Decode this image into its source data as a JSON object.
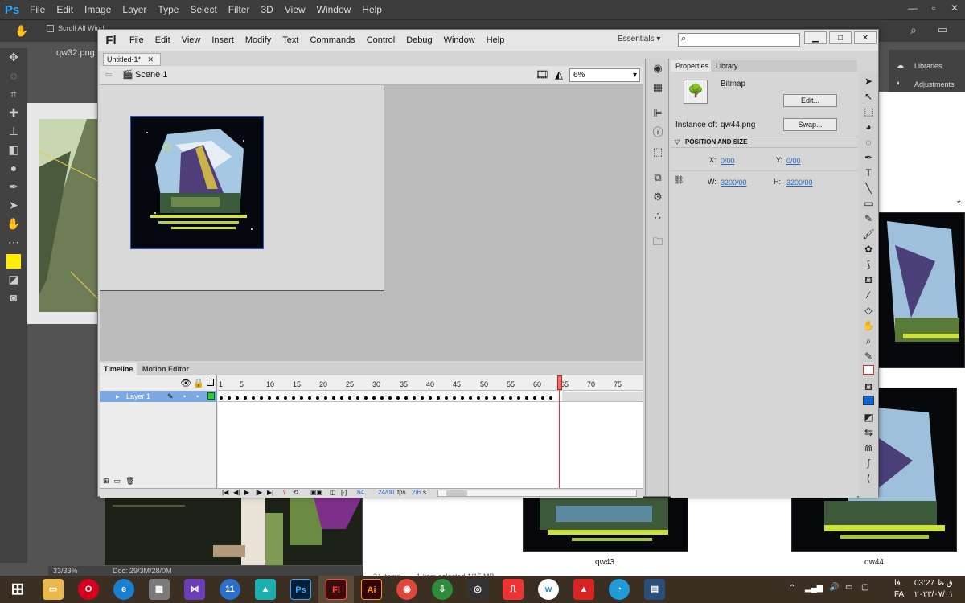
{
  "photoshop": {
    "logo": "Ps",
    "menu": [
      "File",
      "Edit",
      "Image",
      "Layer",
      "Type",
      "Select",
      "Filter",
      "3D",
      "View",
      "Window",
      "Help"
    ],
    "option_label": "Scroll All Wind",
    "doc_tab": "qw32.png @",
    "status_zoom": "33/33%",
    "status_doc": "Doc: 29/3M/28/0M",
    "panels": [
      "Libraries",
      "Adjustments"
    ]
  },
  "explorer": {
    "items": [
      {
        "name": "qw43"
      },
      {
        "name": "qw44"
      }
    ],
    "status_items": "34 items",
    "status_selected": "1 item selected  1/15 MB"
  },
  "flash": {
    "logo": "Fl",
    "menu": [
      "File",
      "Edit",
      "View",
      "Insert",
      "Modify",
      "Text",
      "Commands",
      "Control",
      "Debug",
      "Window",
      "Help"
    ],
    "workspace": "Essentials",
    "doc_tab": "Untitled-1*",
    "scene": "Scene 1",
    "zoom": "6%",
    "timeline": {
      "tabs": [
        "Timeline",
        "Motion Editor"
      ],
      "layer_name": "Layer 1",
      "frame_numbers": [
        "1",
        "5",
        "10",
        "15",
        "20",
        "25",
        "30",
        "35",
        "40",
        "45",
        "50",
        "55",
        "60",
        "65",
        "70",
        "75"
      ],
      "current_frame": "64",
      "fps": "24/00",
      "fps_unit": "fps",
      "time": "2/6",
      "time_unit": "s"
    },
    "properties": {
      "tabs": [
        "Properties",
        "Library"
      ],
      "type": "Bitmap",
      "edit_button": "Edit...",
      "instance_label": "Instance of:",
      "instance_value": "qw44.png",
      "swap_button": "Swap...",
      "section": "POSITION AND SIZE",
      "x_label": "X:",
      "x_value": "0/00",
      "y_label": "Y:",
      "y_value": "0/00",
      "w_label": "W:",
      "w_value": "3200/00",
      "h_label": "H:",
      "h_value": "3200/00"
    }
  },
  "taskbar": {
    "apps": [
      "file-explorer",
      "opera",
      "edge",
      "calculator",
      "visual-studio",
      "app-11",
      "lumion",
      "photoshop",
      "flash",
      "illustrator",
      "chrome",
      "internet-download-manager",
      "camera",
      "wps",
      "word-w",
      "acrobat",
      "edge-new",
      "movie"
    ],
    "app_labels": {
      "ps": "Ps",
      "fl": "Fl",
      "ai": "Ai",
      "w": "w",
      "app11": "11"
    },
    "lang_top": "فا",
    "lang_bottom": "FA",
    "time": "03:27 ق.ظ",
    "date": "۲۰۲۳/۰۷/۰۱"
  }
}
